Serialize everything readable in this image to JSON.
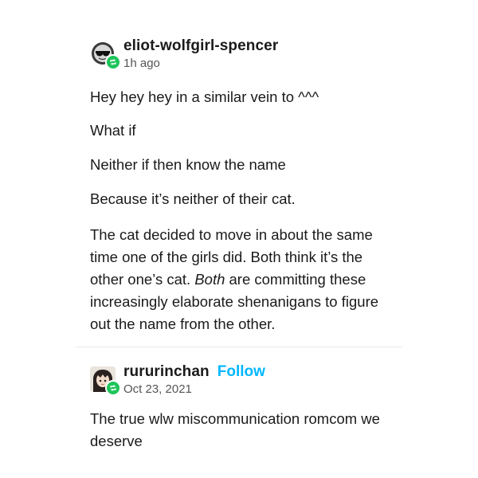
{
  "post1": {
    "username": "eliot-wolfgirl-spencer",
    "timestamp": "1h ago",
    "paragraphs": {
      "p1": "Hey hey hey in a similar vein to ^^^",
      "p2": "What if",
      "p3": "Neither if then know the name",
      "p4": "Because it’s neither of their cat.",
      "p5_before": "The cat decided to move in about the same time one of the girls did. Both think it’s the other one’s cat. ",
      "p5_emphasis": "Both",
      "p5_after": " are committing these increasingly elaborate shenanigans to figure out the name from the other."
    }
  },
  "post2": {
    "username": "rururinchan",
    "follow_label": "Follow",
    "timestamp": "Oct 23, 2021",
    "text": "The true wlw miscommunication romcom we deserve"
  },
  "colors": {
    "follow": "#00b8ff",
    "reblog_badge": "#1ec45a",
    "text": "#1a1a1a",
    "muted": "#555555"
  }
}
